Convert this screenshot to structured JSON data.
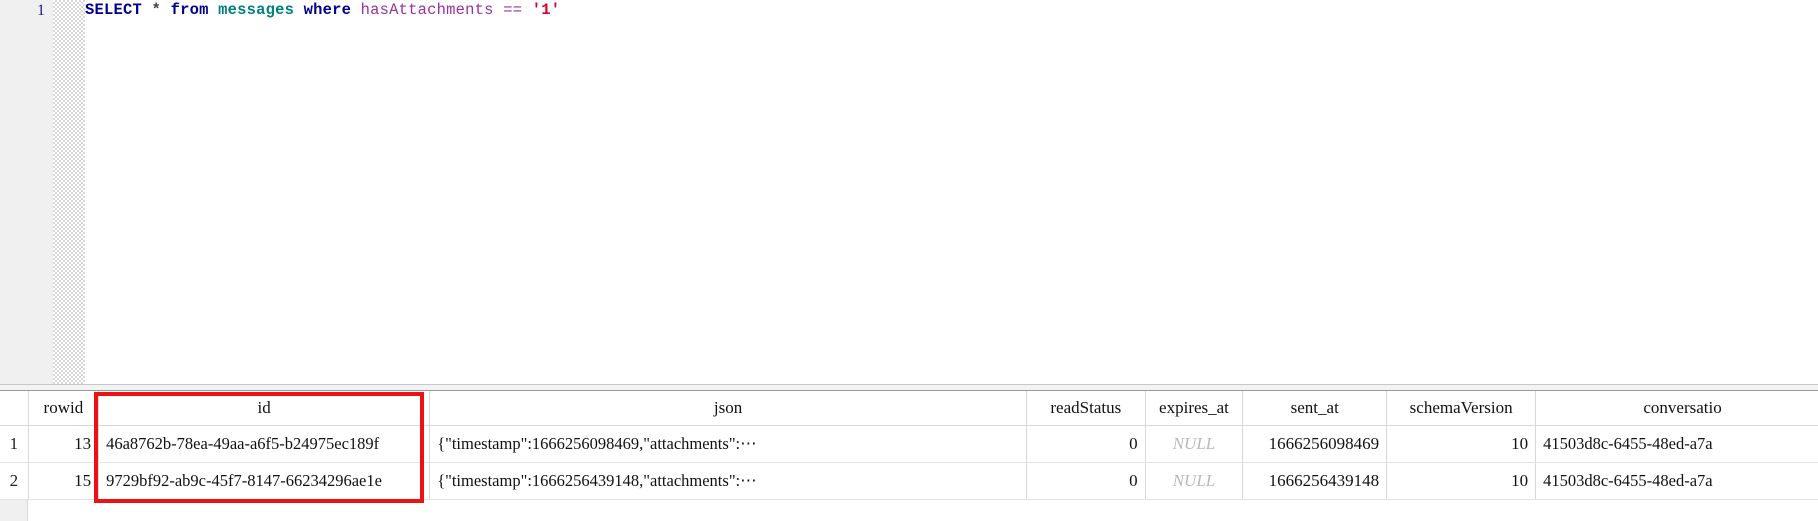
{
  "editor": {
    "line_number": "1",
    "query_tokens": [
      {
        "text": "SELECT",
        "type": "keyword"
      },
      {
        "text": " ",
        "type": "plain"
      },
      {
        "text": "*",
        "type": "star"
      },
      {
        "text": " ",
        "type": "plain"
      },
      {
        "text": "from",
        "type": "keyword"
      },
      {
        "text": " ",
        "type": "plain"
      },
      {
        "text": "messages",
        "type": "table"
      },
      {
        "text": " ",
        "type": "plain"
      },
      {
        "text": "where",
        "type": "keyword"
      },
      {
        "text": " ",
        "type": "plain"
      },
      {
        "text": "hasAttachments",
        "type": "column"
      },
      {
        "text": " ",
        "type": "plain"
      },
      {
        "text": "==",
        "type": "op"
      },
      {
        "text": " ",
        "type": "plain"
      },
      {
        "text": "'1'",
        "type": "string"
      }
    ],
    "query_text": "SELECT * from messages where hasAttachments == '1'"
  },
  "results": {
    "columns": [
      {
        "key": "rownum",
        "label": "",
        "cls": "col-rownum"
      },
      {
        "key": "rowid",
        "label": "rowid",
        "cls": "col-rowid"
      },
      {
        "key": "id",
        "label": "id",
        "cls": "col-id"
      },
      {
        "key": "json",
        "label": "json",
        "cls": "col-json"
      },
      {
        "key": "readStatus",
        "label": "readStatus",
        "cls": "col-readstatus"
      },
      {
        "key": "expires_at",
        "label": "expires_at",
        "cls": "col-expires"
      },
      {
        "key": "sent_at",
        "label": "sent_at",
        "cls": "col-sentat"
      },
      {
        "key": "schemaVersion",
        "label": "schemaVersion",
        "cls": "col-schemaver"
      },
      {
        "key": "conversationId",
        "label": "conversatio",
        "cls": "col-conversation"
      }
    ],
    "rows": [
      {
        "rownum": "1",
        "rowid": "13",
        "id": "46a8762b-78ea-49aa-a6f5-b24975ec189f",
        "json": "{\"timestamp\":1666256098469,\"attachments\":⋯",
        "readStatus": "0",
        "expires_at": "NULL",
        "sent_at": "1666256098469",
        "schemaVersion": "10",
        "conversationId": "41503d8c-6455-48ed-a7a"
      },
      {
        "rownum": "2",
        "rowid": "15",
        "id": "9729bf92-ab9c-45f7-8147-66234296ae1e",
        "json": "{\"timestamp\":1666256439148,\"attachments\":⋯",
        "readStatus": "0",
        "expires_at": "NULL",
        "sent_at": "1666256439148",
        "schemaVersion": "10",
        "conversationId": "41503d8c-6455-48ed-a7a"
      }
    ]
  },
  "annotation": {
    "target_column": "id",
    "color": "#ee1111"
  },
  "colors": {
    "keyword": "#00008f",
    "table": "#008080",
    "column": "#9b30a0",
    "string": "#d6002d",
    "null_text": "#b9b9b9",
    "gutter_bg": "#f0f0f0",
    "grid_border": "#d8d8d8"
  }
}
